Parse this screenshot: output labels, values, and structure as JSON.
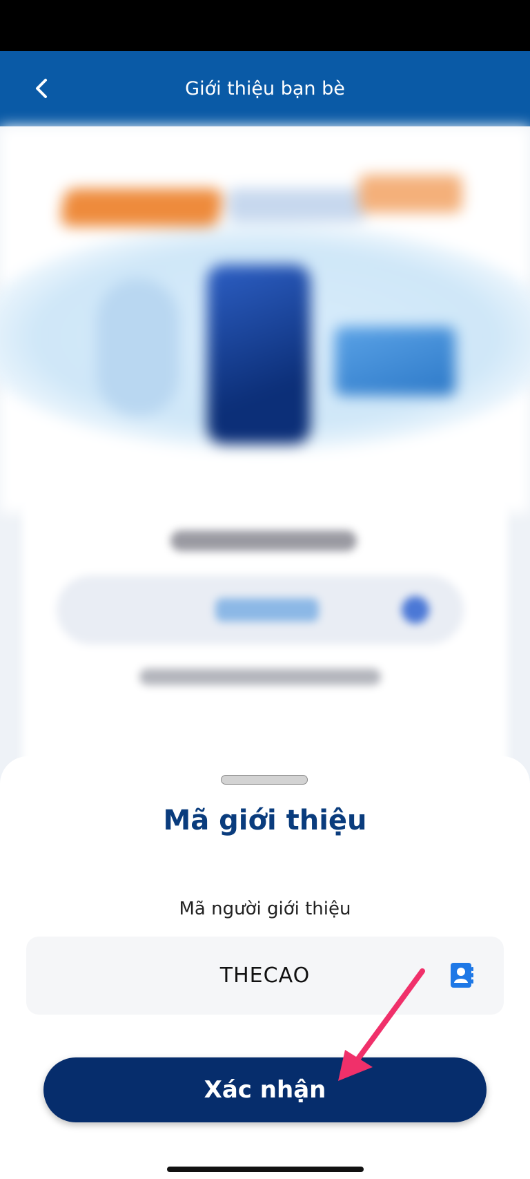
{
  "header": {
    "title": "Giới thiệu bạn bè",
    "back_icon": "chevron-left-icon"
  },
  "sheet": {
    "title": "Mã giới thiệu",
    "field_label": "Mã người giới thiệu",
    "field_value": "THECAO",
    "contact_icon": "contact-book-icon",
    "confirm_label": "Xác nhận"
  },
  "colors": {
    "header_bg": "#0a5aa6",
    "button_bg": "#062d6c",
    "title_text": "#0a3c7d",
    "annotation_arrow": "#f0306a"
  }
}
